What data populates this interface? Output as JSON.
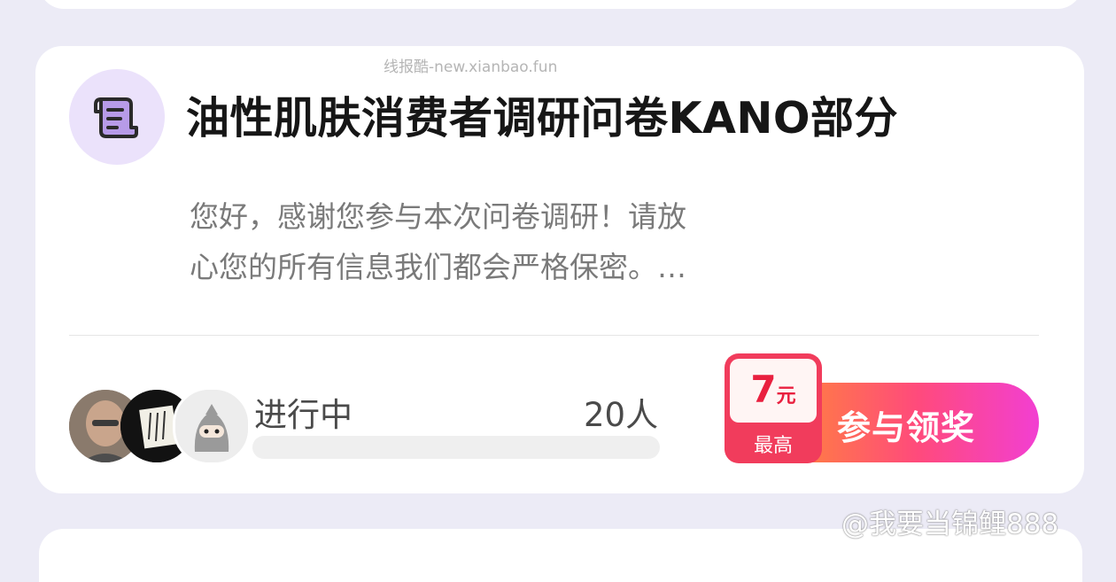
{
  "watermark": "线报酷-new.xianbao.fun",
  "survey": {
    "icon": "scroll-document-icon",
    "title": "油性肌肤消费者调研问卷KANO部分",
    "description_line1": "您好，感谢您参与本次问卷调研！请放",
    "description_line2": "心您的所有信息我们都会严格保密。…",
    "status": "进行中",
    "participants": "20人",
    "progress": 0
  },
  "reward": {
    "amount": "7",
    "unit": "元",
    "label": "最高"
  },
  "join_button": "参与领奖",
  "weibo_watermark": "@我要当锦鲤888",
  "colors": {
    "accent": "#ff4a7c",
    "reward_red": "#f13c5c",
    "icon_bg": "#ebe2fb",
    "icon_stroke": "#2a2a2a"
  }
}
